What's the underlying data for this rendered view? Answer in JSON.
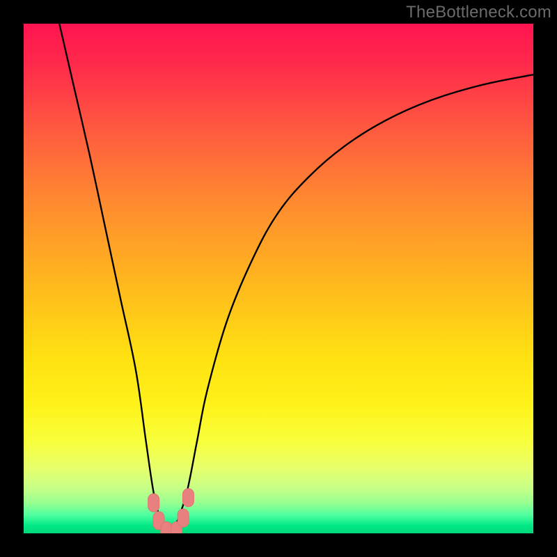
{
  "watermark": "TheBottleneck.com",
  "colors": {
    "frame": "#000000",
    "curve": "#000000",
    "marker_fill": "#e98080",
    "marker_stroke": "#e17272",
    "gradient_stops": [
      {
        "offset": 0.0,
        "color": "#ff1450"
      },
      {
        "offset": 0.08,
        "color": "#ff2a4b"
      },
      {
        "offset": 0.2,
        "color": "#ff5740"
      },
      {
        "offset": 0.35,
        "color": "#ff8a30"
      },
      {
        "offset": 0.5,
        "color": "#ffb51e"
      },
      {
        "offset": 0.65,
        "color": "#ffe012"
      },
      {
        "offset": 0.75,
        "color": "#fff21a"
      },
      {
        "offset": 0.82,
        "color": "#f7ff3c"
      },
      {
        "offset": 0.87,
        "color": "#e8ff6a"
      },
      {
        "offset": 0.91,
        "color": "#c8ff86"
      },
      {
        "offset": 0.94,
        "color": "#98ff90"
      },
      {
        "offset": 0.965,
        "color": "#4cffa0"
      },
      {
        "offset": 0.985,
        "color": "#00e884"
      },
      {
        "offset": 1.0,
        "color": "#00d878"
      }
    ]
  },
  "chart_data": {
    "type": "line",
    "title": "",
    "xlabel": "",
    "ylabel": "",
    "xlim": [
      0,
      100
    ],
    "ylim": [
      0,
      100
    ],
    "grid": false,
    "series": [
      {
        "name": "bottleneck-curve",
        "x": [
          7,
          10,
          13,
          16,
          19,
          22,
          24,
          25.5,
          27,
          28,
          29,
          30,
          32,
          34,
          36,
          40,
          45,
          50,
          56,
          63,
          71,
          80,
          90,
          100
        ],
        "y": [
          100,
          87,
          74,
          60,
          46,
          32,
          18,
          8,
          2,
          0,
          0,
          2,
          8,
          18,
          28,
          42,
          54,
          63,
          70,
          76,
          81,
          85,
          88,
          90
        ]
      }
    ],
    "markers": {
      "name": "highlight-points",
      "points": [
        {
          "x": 25.5,
          "y": 6
        },
        {
          "x": 26.5,
          "y": 2.5
        },
        {
          "x": 28,
          "y": 0.5
        },
        {
          "x": 30,
          "y": 0.5
        },
        {
          "x": 31.3,
          "y": 3
        },
        {
          "x": 32.3,
          "y": 7
        }
      ]
    }
  }
}
